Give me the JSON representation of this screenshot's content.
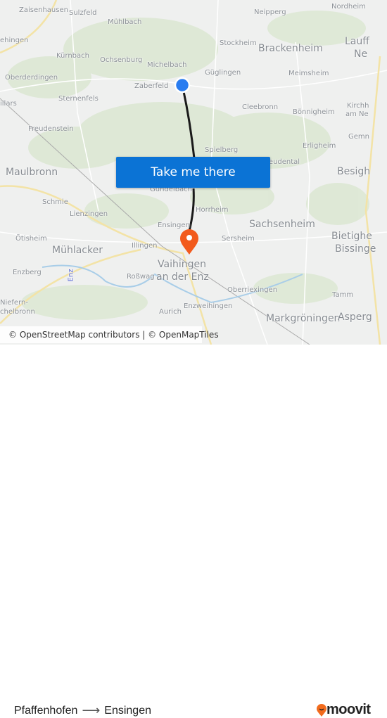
{
  "map": {
    "labels": [
      "Zaisenhausen",
      "Sulzfeld",
      "Mühlbach",
      "ehingen",
      "Neipperg",
      "Nordheim",
      "Stockheim",
      "Brackenheim",
      "Lauff",
      "Ne",
      "Kürnbach",
      "Ochsenburg",
      "Michelbach",
      "Güglingen",
      "Meimsheim",
      "Oberderdingen",
      "Zaberfeld",
      "illars",
      "Sternenfels",
      "Cleebronn",
      "Bönnigheim",
      "Kirchh",
      "am Ne",
      "Freudenstein",
      "Gemn",
      "Erligheim",
      "Spielberg",
      "Freudental",
      "Maulbronn",
      "Besigh",
      "Gündelbach",
      "Schmie",
      "Lienzingen",
      "Horrheim",
      "Ensingen",
      "Sachsenheim",
      "Ötisheim",
      "Sersheim",
      "Bietighe",
      "Bissinge",
      "Mühlacker",
      "Illingen",
      "Vaihingen",
      "an der Enz",
      "Enzberg",
      "Roßwag",
      "Oberriexingen",
      "Tamm",
      "Niefern-",
      "chelbronn",
      "Enzweihingen",
      "Aurich",
      "Markgröningen",
      "Asperg",
      "Enz"
    ],
    "origin_color": "#2a7df0",
    "destination_color": "#f25a1c",
    "route_color": "#1a1a1a"
  },
  "cta": {
    "label": "Take me there",
    "color": "#0b73d5"
  },
  "attribution": "© OpenStreetMap contributors | © OpenMapTiles",
  "footer": {
    "from": "Pfaffenhofen",
    "arrow": "⟶",
    "to": "Ensingen",
    "brand": "moovit",
    "brand_color": "#f26b1d"
  }
}
